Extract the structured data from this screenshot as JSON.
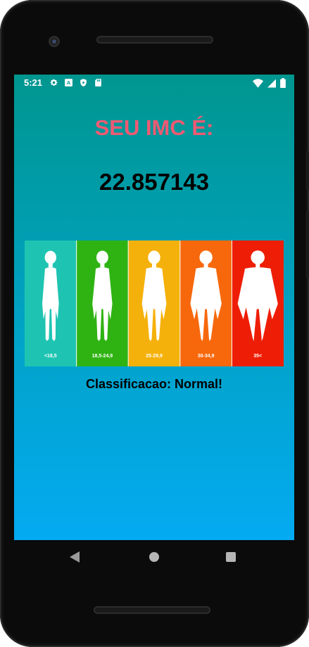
{
  "statusbar": {
    "time": "5:21",
    "left_icons": [
      "gear-icon",
      "a-box-icon",
      "shield-play-icon",
      "sd-card-icon"
    ],
    "right_icons": [
      "wifi-icon",
      "cell-signal-icon",
      "battery-icon"
    ]
  },
  "main": {
    "title": "SEU IMC É:",
    "value": "22.857143",
    "classification": "Classificacao: Normal!"
  },
  "bmi_chart": {
    "categories": [
      {
        "label": "<18,5",
        "color": "#1ec4b1"
      },
      {
        "label": "18,5-24,9",
        "color": "#2fb313"
      },
      {
        "label": "25-29,9",
        "color": "#f5b10b"
      },
      {
        "label": "30-34,9",
        "color": "#f7680c"
      },
      {
        "label": "35<",
        "color": "#ee1e06"
      }
    ]
  },
  "colors": {
    "title": "#ee5a73",
    "gradient_top": "#00968f",
    "gradient_bottom": "#04aaf2"
  },
  "navbar": {
    "icons": [
      "back-icon",
      "home-icon",
      "recent-apps-icon"
    ]
  }
}
